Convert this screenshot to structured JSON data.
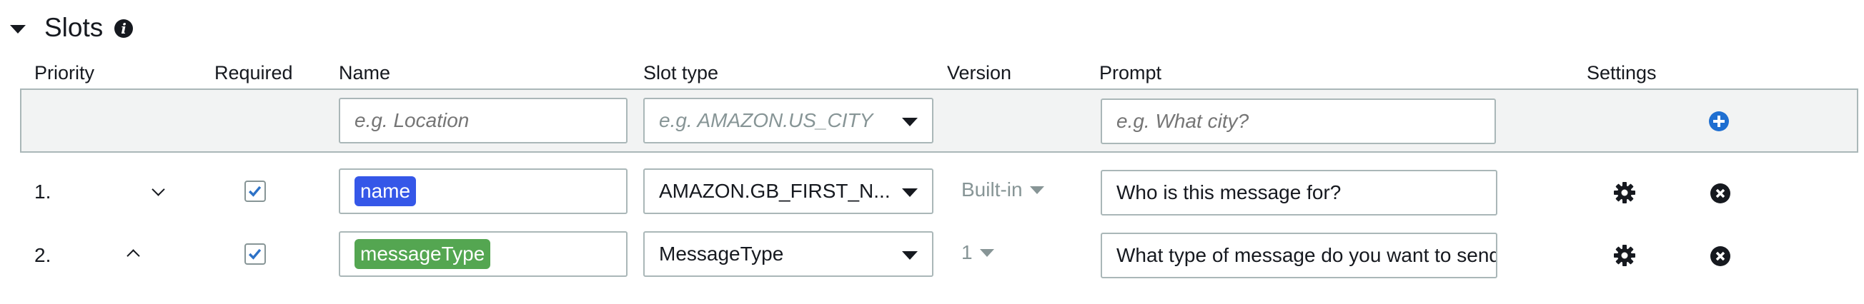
{
  "section": {
    "title": "Slots"
  },
  "columns": {
    "priority": "Priority",
    "required": "Required",
    "name": "Name",
    "slot_type": "Slot type",
    "version": "Version",
    "prompt": "Prompt",
    "settings": "Settings"
  },
  "new_slot": {
    "name_placeholder": "e.g. Location",
    "slot_type_placeholder": "e.g. AMAZON.US_CITY",
    "prompt_placeholder": "e.g. What city?"
  },
  "slots": [
    {
      "priority": "1.",
      "required": true,
      "name": "name",
      "name_color": "#3557e8",
      "slot_type": "AMAZON.GB_FIRST_N...",
      "version": "Built-in",
      "prompt": "Who is this message for?"
    },
    {
      "priority": "2.",
      "required": true,
      "name": "messageType",
      "name_color": "#54a651",
      "slot_type": "MessageType",
      "version": "1",
      "prompt": "What type of message do you want to send?"
    }
  ],
  "colors": {
    "accent_blue": "#1f6fd1",
    "checkbox_blue": "#2d72c7",
    "border": "#aab7b8",
    "muted": "#879596"
  },
  "icons": {
    "info": "info-icon",
    "add": "plus-circle-icon",
    "settings": "gear-icon",
    "remove": "close-circle-icon",
    "move_down": "chevron-down-icon",
    "move_up": "chevron-up-icon"
  }
}
